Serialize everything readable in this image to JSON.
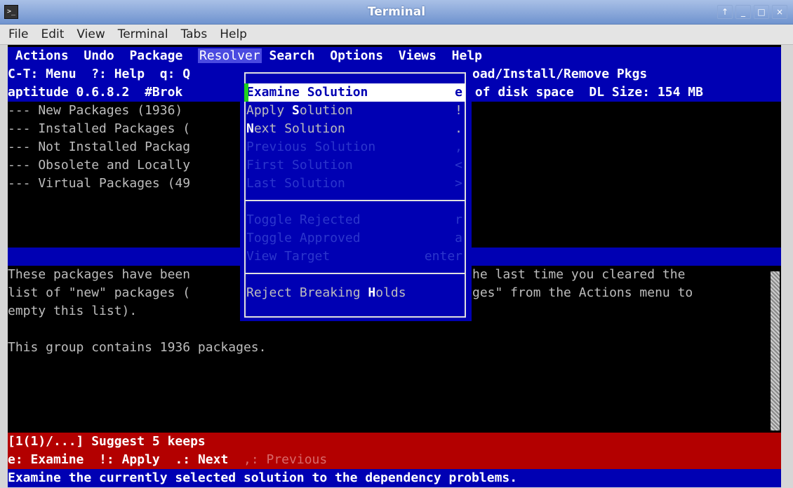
{
  "window": {
    "title": "Terminal",
    "buttons": [
      "↑",
      "_",
      "□",
      "×"
    ]
  },
  "menubar": [
    "File",
    "Edit",
    "View",
    "Terminal",
    "Tabs",
    "Help"
  ],
  "aptitude": {
    "top_menu": [
      "Actions",
      "Undo",
      "Package",
      "Resolver",
      "Search",
      "Options",
      "Views",
      "Help"
    ],
    "active_menu": "Resolver",
    "keys_left": "C-T: Menu  ?: Help  q: Q",
    "keys_right": "oad/Install/Remove Pkgs",
    "status_left": "aptitude 0.6.8.2  #Brok",
    "status_right": " of disk space  DL Size: 154 MB",
    "tree": [
      "--- New Packages (1936)",
      "--- Installed Packages (",
      "--- Not Installed Packag",
      "--- Obsolete and Locally",
      "--- Virtual Packages (49"
    ],
    "description": [
      {
        "left": "These packages have been",
        "right": "he last time you cleared the"
      },
      {
        "left": "list of \"new\" packages (",
        "right": "ges\" from the Actions menu to"
      },
      {
        "left": "empty this list).",
        "right": ""
      }
    ],
    "group_info": "This group contains 1936 packages.",
    "resolver_status": "[1(1)/...] Suggest 5 keeps",
    "resolver_keys": {
      "k1": "e: Examine",
      "k2": "!: Apply",
      "k3": ".: Next",
      "k4": ",: Previous"
    },
    "help_line": "Examine the currently selected solution to the dependency problems."
  },
  "resolver_menu": {
    "items": [
      {
        "pre": "",
        "hot": "E",
        "post": "xamine Solution",
        "key": "e",
        "state": "selected"
      },
      {
        "pre": "Apply ",
        "hot": "S",
        "post": "olution",
        "key": "!",
        "state": "enabled"
      },
      {
        "pre": "",
        "hot": "N",
        "post": "ext Solution",
        "key": ".",
        "state": "enabled"
      },
      {
        "pre": "Previous Solution",
        "hot": "",
        "post": "",
        "key": ",",
        "state": "disabled"
      },
      {
        "pre": "First Solution",
        "hot": "",
        "post": "",
        "key": "<",
        "state": "disabled"
      },
      {
        "pre": "Last Solution",
        "hot": "",
        "post": "",
        "key": ">",
        "state": "disabled"
      },
      {
        "pre": "Toggle Rejected",
        "hot": "",
        "post": "",
        "key": "r",
        "state": "disabled"
      },
      {
        "pre": "Toggle Approved",
        "hot": "",
        "post": "",
        "key": "a",
        "state": "disabled"
      },
      {
        "pre": "View Target",
        "hot": "",
        "post": "",
        "key": "enter",
        "state": "disabled"
      },
      {
        "pre": "Reject Breaking ",
        "hot": "H",
        "post": "olds",
        "key": "",
        "state": "enabled"
      }
    ]
  },
  "colors": {
    "terminal_blue": "#0000b3",
    "terminal_red": "#b30000",
    "cursor_green": "#1fd31f"
  }
}
